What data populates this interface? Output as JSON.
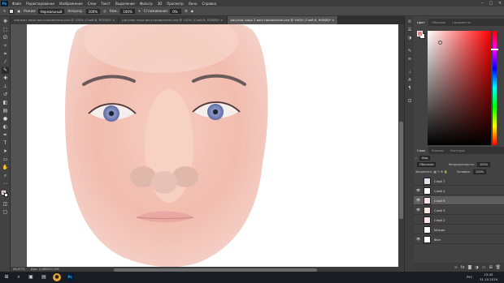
{
  "app": {
    "logo": "Ps"
  },
  "menu": [
    "Файл",
    "Редактирование",
    "Изображение",
    "Слои",
    "Текст",
    "Выделение",
    "Фильтр",
    "3D",
    "Просмотр",
    "Окно",
    "Справка"
  ],
  "window_controls": {
    "minimize": "–",
    "maximize": "□",
    "close": "×"
  },
  "options_bar": {
    "mode_label": "Режим:",
    "mode_value": "Нормальный",
    "opacity_label": "Непрозр.:",
    "opacity_value": "100%",
    "flow_label": "Наж.:",
    "flow_value": "100%",
    "smoothing_label": "Сглаживание:",
    "smoothing_value": "0%"
  },
  "tabs": [
    {
      "label": "портрет лицо восстановление.psd @ 100% (Слой 6, RGB/8)* ×",
      "active": false
    },
    {
      "label": "рисунок лица восстановление.psd @ 100% (Слой 6, RGB/8)* ×",
      "active": false
    },
    {
      "label": "рисунок лица 2 восстановление.psd @ 200% (Слой 6, RGB/8)* ×",
      "active": true
    }
  ],
  "status": {
    "zoom": "66,67%",
    "doc": "Док: 2,68M/10,0M"
  },
  "color_panel": {
    "tabs": [
      "Цвет",
      "Образцы",
      "Градиенты"
    ],
    "fg": "#d98a86",
    "bg": "#ffffff"
  },
  "layers_panel": {
    "tabs": [
      "Слои",
      "Каналы",
      "Контуры"
    ],
    "kind_label": "Вид",
    "blend_mode": "Обычные",
    "opacity_label": "Непрозрачность:",
    "opacity_value": "100%",
    "lock_label": "Закрепить:",
    "fill_label": "Заливка:",
    "fill_value": "100%",
    "layers": [
      {
        "name": "Слой 7",
        "visible": false,
        "selected": false
      },
      {
        "name": "Слой 4",
        "visible": true,
        "selected": false
      },
      {
        "name": "Слой 6",
        "visible": true,
        "selected": true
      },
      {
        "name": "Слой 3",
        "visible": true,
        "selected": false
      },
      {
        "name": "Слой 2",
        "visible": false,
        "selected": false
      },
      {
        "name": "Штрих",
        "visible": false,
        "selected": false
      },
      {
        "name": "Фон",
        "visible": true,
        "selected": false
      }
    ]
  },
  "taskbar": {
    "time": "15:45",
    "date": "31.10.2019",
    "lang": "РУС"
  }
}
